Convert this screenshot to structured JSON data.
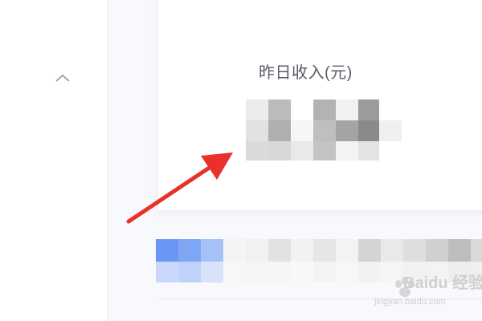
{
  "card": {
    "title": "昨日收入(元)"
  },
  "icons": {
    "collapse": "chevron-up-icon",
    "annotation": "red-arrow-icon"
  },
  "colors": {
    "arrow": "#e8302c",
    "accent_blue": "#6a97f5",
    "title_text": "#595c66"
  },
  "watermark": {
    "brand": "Baidu 经验",
    "url": "jingyan.baidu.com"
  }
}
